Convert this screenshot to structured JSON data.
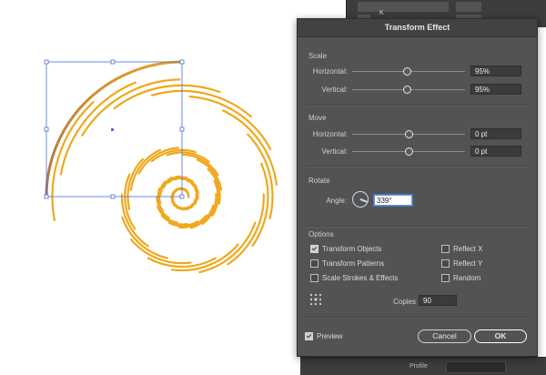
{
  "background_panel": {
    "rows": [
      "K"
    ]
  },
  "bottom_panel": {
    "label": "Profile"
  },
  "dialog": {
    "title": "Transform Effect",
    "scale": {
      "heading": "Scale",
      "horizontal_label": "Horizontal:",
      "horizontal_value": "95%",
      "horizontal_slider": 0.48,
      "vertical_label": "Vertical:",
      "vertical_value": "95%",
      "vertical_slider": 0.48
    },
    "move": {
      "heading": "Move",
      "horizontal_label": "Horizontal:",
      "horizontal_value": "0 pt",
      "horizontal_slider": 0.5,
      "vertical_label": "Vertical:",
      "vertical_value": "0 pt",
      "vertical_slider": 0.5
    },
    "rotate": {
      "heading": "Rotate",
      "angle_label": "Angle:",
      "angle_value": "339°"
    },
    "options": {
      "heading": "Options",
      "transform_objects": {
        "label": "Transform Objects",
        "checked": true
      },
      "transform_patterns": {
        "label": "Transform Patterns",
        "checked": false
      },
      "scale_strokes": {
        "label": "Scale Strokes & Effects",
        "checked": false
      },
      "reflect_x": {
        "label": "Reflect X",
        "checked": false
      },
      "reflect_y": {
        "label": "Reflect Y",
        "checked": false
      },
      "random": {
        "label": "Random",
        "checked": false
      }
    },
    "copies_label": "Copies",
    "copies_value": "90",
    "preview": {
      "label": "Preview",
      "checked": true
    },
    "cancel_label": "Cancel",
    "ok_label": "OK"
  },
  "colors": {
    "spiral_stroke": "#f0a81c",
    "spiral_gradient_start": "#b07a3a",
    "selection": "#4a6ed8",
    "dialog_bg": "#535353"
  }
}
